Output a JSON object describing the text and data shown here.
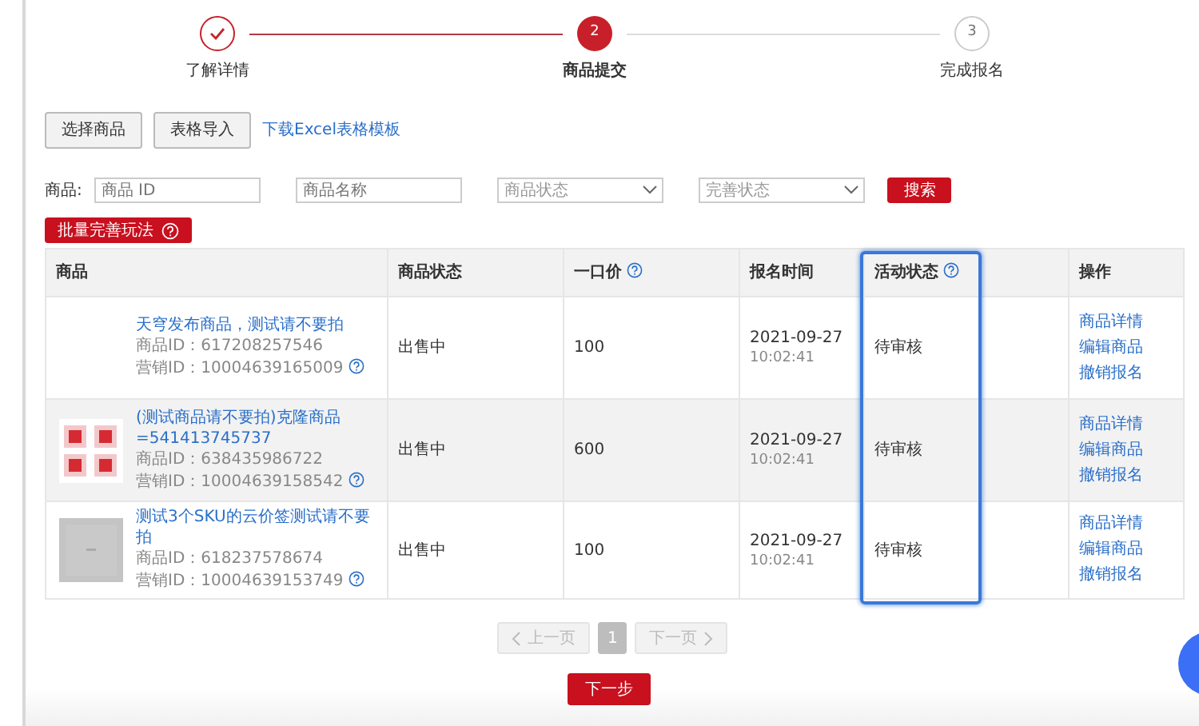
{
  "steps": [
    {
      "label": "了解详情",
      "done": true,
      "selected": false
    },
    {
      "label": "商品提交",
      "done": false,
      "selected": true,
      "marker": "2"
    },
    {
      "label": "完成报名",
      "done": false,
      "selected": false,
      "marker": "3"
    }
  ],
  "toolbar": {
    "buttons": [
      "选择商品",
      "表格导入"
    ],
    "link": "下载Excel表格模板"
  },
  "filters": {
    "label": "商品:",
    "fields": [
      {
        "kind": "input",
        "placeholder": "商品 ID"
      },
      {
        "kind": "input",
        "placeholder": "商品名称"
      },
      {
        "kind": "select",
        "placeholder": "商品状态"
      },
      {
        "kind": "select",
        "placeholder": "完善状态"
      }
    ],
    "search_button": "搜索"
  },
  "batch_button": "批量完善玩法",
  "table": {
    "columns": [
      {
        "label": "商品",
        "help": false
      },
      {
        "label": "商品状态",
        "help": false
      },
      {
        "label": "一口价",
        "help": true
      },
      {
        "label": "报名时间",
        "help": false
      },
      {
        "label": "活动状态",
        "help": true
      },
      {
        "label": "操作",
        "help": false
      }
    ],
    "rows": [
      {
        "hovered": false,
        "title": "天穹发布商品，测试请不要拍",
        "product_id": "商品ID：617208257546",
        "marketing_id": "营销ID：10004639165009",
        "status": "出售中",
        "price": "100",
        "date": "2021-09-27",
        "time": "10:02:41",
        "activity_status": "待审核",
        "actions": [
          "商品详情",
          "编辑商品",
          "撤销报名"
        ]
      },
      {
        "hovered": true,
        "thumbnail": {
          "kind": "picture"
        },
        "title": "(测试商品请不要拍)克隆商品=541413745737",
        "product_id": "商品ID：638435986722",
        "marketing_id": "营销ID：10004639158542",
        "status": "出售中",
        "price": "600",
        "date": "2021-09-27",
        "time": "10:02:41",
        "activity_status": "待审核",
        "actions": [
          "商品详情",
          "编辑商品",
          "撤销报名"
        ]
      },
      {
        "hovered": false,
        "thumbnail": {
          "kind": "picture"
        },
        "title": "测试3个SKU的云价签测试请不要拍",
        "product_id": "商品ID：618237578674",
        "marketing_id": "营销ID：10004639153749",
        "status": "出售中",
        "price": "100",
        "date": "2021-09-27",
        "time": "10:02:41",
        "activity_status": "待审核",
        "actions": [
          "商品详情",
          "编辑商品",
          "撤销报名"
        ]
      }
    ]
  },
  "pagination": {
    "prev": "上一页",
    "next": "下一页",
    "pages": [
      {
        "label": "1",
        "selected": true
      }
    ],
    "prev_disabled": true,
    "next_disabled": true
  },
  "next_button": "下一步"
}
